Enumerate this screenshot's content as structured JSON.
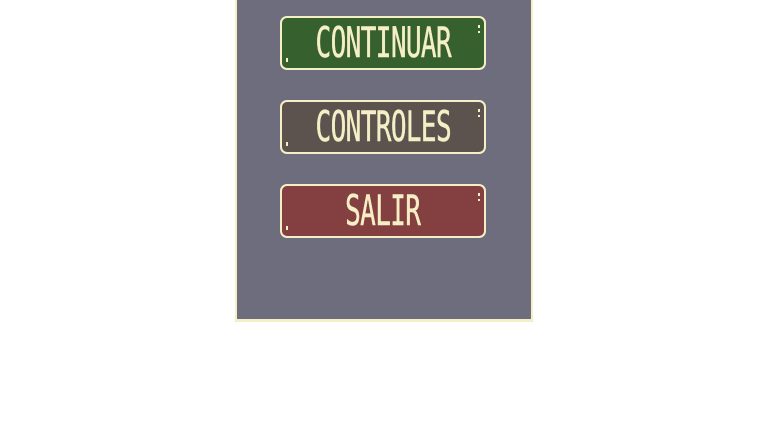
{
  "pause_menu": {
    "buttons": [
      {
        "label": "CONTINUAR",
        "color": "#37602f"
      },
      {
        "label": "CONTROLES",
        "color": "#5d534e"
      },
      {
        "label": "SALIR",
        "color": "#843f40"
      }
    ]
  },
  "theme": {
    "panel_color": "#6e6d7e",
    "border_color": "#f5efc6",
    "text_color": "#f5efc6"
  }
}
